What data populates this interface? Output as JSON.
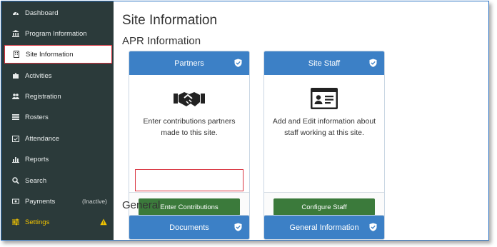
{
  "sidebar": {
    "items": [
      {
        "label": "Dashboard",
        "icon": "dashboard-icon"
      },
      {
        "label": "Program Information",
        "icon": "institution-icon"
      },
      {
        "label": "Site Information",
        "icon": "building-icon",
        "active": true
      },
      {
        "label": "Activities",
        "icon": "puzzle-icon"
      },
      {
        "label": "Registration",
        "icon": "users-icon"
      },
      {
        "label": "Rosters",
        "icon": "list-icon"
      },
      {
        "label": "Attendance",
        "icon": "calendar-check-icon"
      },
      {
        "label": "Reports",
        "icon": "bar-chart-icon"
      },
      {
        "label": "Search",
        "icon": "search-icon"
      },
      {
        "label": "Payments",
        "icon": "money-icon",
        "tag": "(Inactive)"
      },
      {
        "label": "Settings",
        "icon": "sliders-icon",
        "warning": true
      }
    ]
  },
  "main": {
    "title": "Site Information",
    "section_apr": "APR Information",
    "section_general": "General",
    "cards": {
      "partners": {
        "header": "Partners",
        "description": "Enter contributions partners made to this site.",
        "button": "Enter Contributions"
      },
      "site_staff": {
        "header": "Site Staff",
        "description": "Add and Edit information about staff working at this site.",
        "button": "Configure Staff"
      },
      "documents": {
        "header": "Documents"
      },
      "general_information": {
        "header": "General Information"
      }
    }
  },
  "colors": {
    "sidebar_bg": "#2b3a3a",
    "card_header": "#3c80c6",
    "button_green": "#3b7a3b",
    "highlight_red": "#d9333f",
    "settings_yellow": "#f2c400"
  }
}
